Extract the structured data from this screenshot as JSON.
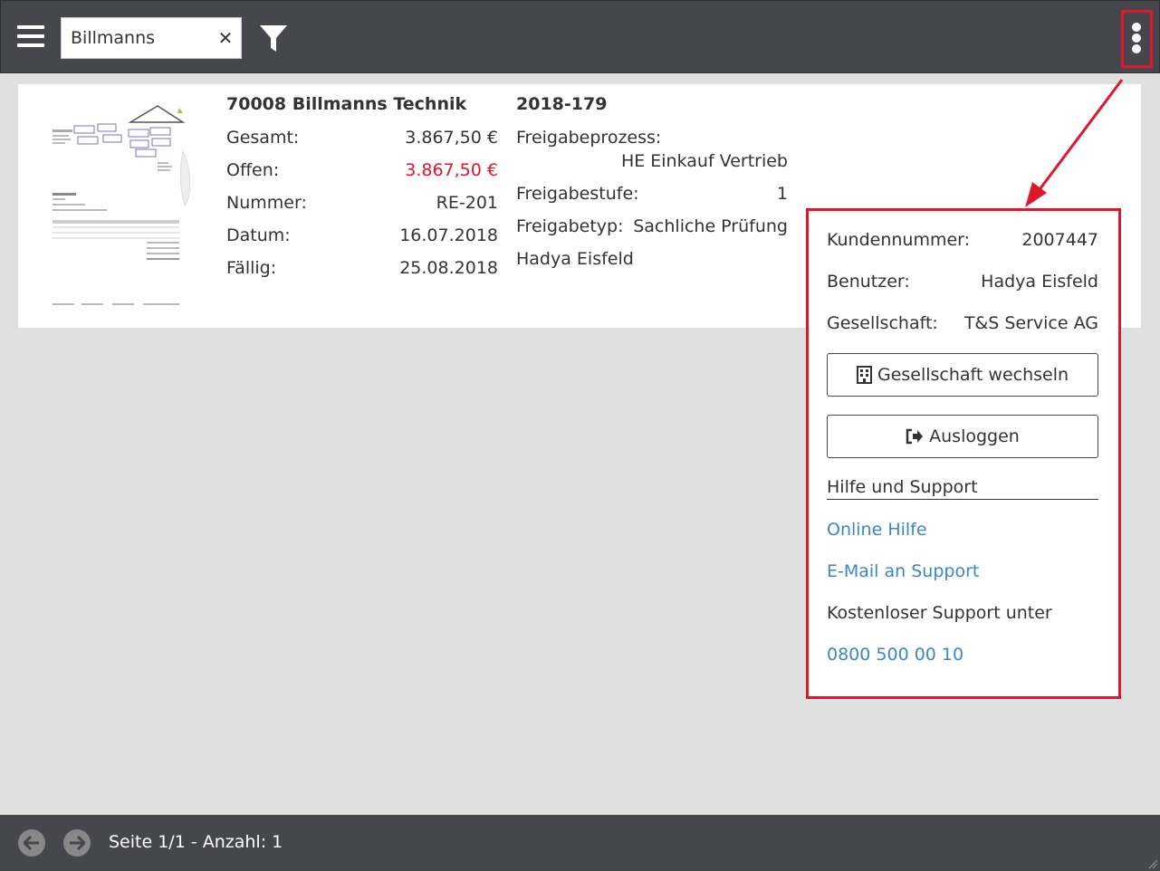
{
  "search": {
    "value": "Billmanns",
    "clear_symbol": "✕"
  },
  "icons": {
    "menu": "hamburger-icon",
    "filter": "filter-icon",
    "more": "kebab-icon",
    "company": "building-icon",
    "logout": "sign-out-icon",
    "prev": "arrow-left-icon",
    "next": "arrow-right-icon"
  },
  "colors": {
    "topbar": "#46474d",
    "highlight": "#e0162b",
    "link": "#3a87c6",
    "open_amount": "#e0162b"
  },
  "invoice": {
    "title": "70008 Billmanns Technik",
    "rows": [
      {
        "label": "Gesamt:",
        "value": "3.867,50 €"
      },
      {
        "label": "Offen:",
        "value": "3.867,50 €"
      },
      {
        "label": "Nummer:",
        "value": "RE-201"
      },
      {
        "label": "Datum:",
        "value": "16.07.2018"
      },
      {
        "label": "Fällig:",
        "value": "25.08.2018"
      }
    ],
    "approval": {
      "id": "2018-179",
      "process_label": "Freigabeprozess:",
      "process_value": "HE Einkauf Vertrieb",
      "step_label": "Freigabestufe:",
      "step_value": "1",
      "type_label": "Freigabetyp:",
      "type_value": "Sachliche Prüfung",
      "user": "Hadya Eisfeld"
    }
  },
  "menu": {
    "customer_label": "Kundennummer:",
    "customer_value": "2007447",
    "user_label": "Benutzer:",
    "user_value": "Hadya Eisfeld",
    "company_label": "Gesellschaft:",
    "company_value": "T&S Service AG",
    "switch_company": "Gesellschaft wechseln",
    "logout": "Ausloggen",
    "help_heading": "Hilfe und Support",
    "online_help": "Online Hilfe",
    "email_support": "E-Mail an Support",
    "free_support": "Kostenloser Support unter",
    "phone": "0800 500 00 10"
  },
  "footer": {
    "page": "Seite 1/1",
    "separator": " - ",
    "count": "Anzahl: 1"
  }
}
